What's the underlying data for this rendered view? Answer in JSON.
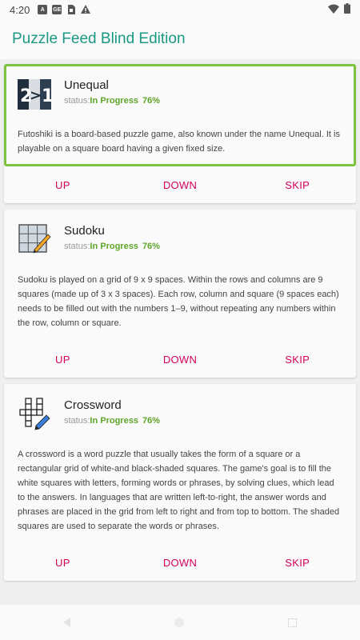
{
  "status_bar": {
    "time": "4:20",
    "icons": [
      "a-badge-icon",
      "ge-badge-icon",
      "sim-icon",
      "alert-icon",
      "wifi-icon",
      "battery-icon"
    ]
  },
  "app_bar": {
    "title": "Puzzle Feed Blind Edition"
  },
  "colors": {
    "accent": "#1b9883",
    "status": "#5ea52a",
    "action": "#d6005a",
    "selected_border": "#7dc241"
  },
  "cards": [
    {
      "title": "Unequal",
      "status_label": "status:",
      "status_value": "In Progress",
      "percent": "76%",
      "description": "Futoshiki is a board-based puzzle game, also known under the name Unequal. It is playable on a square board having a given fixed size.",
      "actions": {
        "up": "UP",
        "down": "DOWN",
        "skip": "SKIP"
      },
      "icon": "unequal-icon",
      "selected": true
    },
    {
      "title": "Sudoku",
      "status_label": "status:",
      "status_value": "In Progress",
      "percent": "76%",
      "description": "Sudoku is played on a grid of 9 x 9 spaces. Within the rows and columns are 9 squares (made up of 3 x 3 spaces). Each row, column and square (9 spaces each) needs to be filled out with the numbers 1–9, without repeating any numbers within the row, column or square.",
      "actions": {
        "up": "UP",
        "down": "DOWN",
        "skip": "SKIP"
      },
      "icon": "sudoku-icon",
      "selected": false
    },
    {
      "title": "Crossword",
      "status_label": "status:",
      "status_value": "In Progress",
      "percent": "76%",
      "description": "A crossword is a word puzzle that usually takes the form of a square or a rectangular grid of white-and black-shaded squares. The game's goal is to fill the white squares with letters, forming words or phrases, by solving clues, which lead to the answers. In languages that are written left-to-right, the answer words and phrases are placed in the grid from left to right and from top to bottom. The shaded squares are used to separate the words or phrases.",
      "actions": {
        "up": "UP",
        "down": "DOWN",
        "skip": "SKIP"
      },
      "icon": "crossword-icon",
      "selected": false
    }
  ]
}
